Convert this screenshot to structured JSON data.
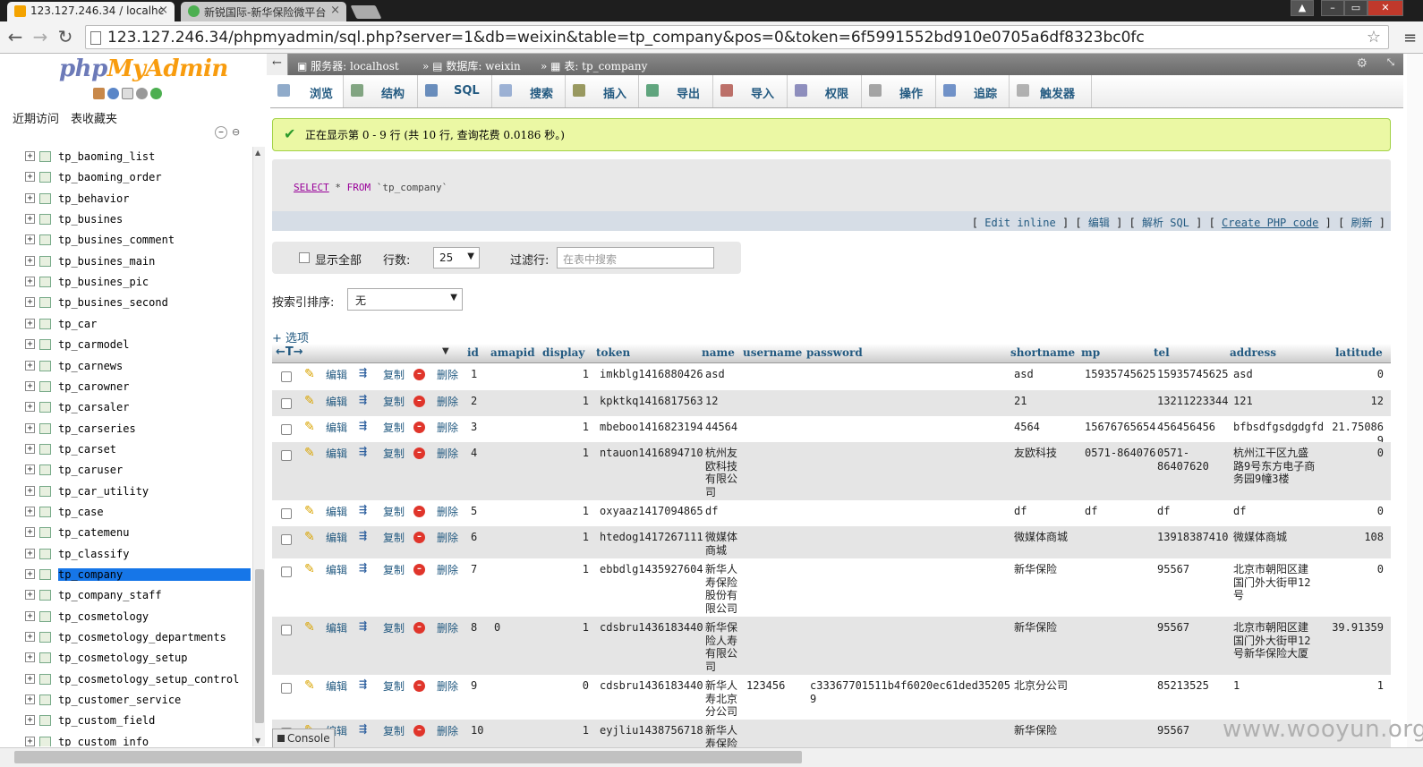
{
  "browser": {
    "tabs": [
      {
        "title": "123.127.246.34 / localhc",
        "close": "×"
      },
      {
        "title": "新锐国际-新华保险微平台",
        "close": "×"
      }
    ],
    "url": "123.127.246.34/phpmyadmin/sql.php?server=1&db=weixin&table=tp_company&pos=0&token=6f5991552bd910e0705a6df8323bc0fc",
    "nav": {
      "back": "←",
      "forward": "→",
      "reload": "↻",
      "star": "☆",
      "menu": "≡"
    }
  },
  "sidebar": {
    "logo_a": "php",
    "logo_b": "MyAdmin",
    "tab_recent": "近期访问",
    "tab_favorites": "表收藏夹",
    "tables": [
      "tp_baoming_list",
      "tp_baoming_order",
      "tp_behavior",
      "tp_busines",
      "tp_busines_comment",
      "tp_busines_main",
      "tp_busines_pic",
      "tp_busines_second",
      "tp_car",
      "tp_carmodel",
      "tp_carnews",
      "tp_carowner",
      "tp_carsaler",
      "tp_carseries",
      "tp_carset",
      "tp_caruser",
      "tp_car_utility",
      "tp_case",
      "tp_catemenu",
      "tp_classify",
      "tp_company",
      "tp_company_staff",
      "tp_cosmetology",
      "tp_cosmetology_departments",
      "tp_cosmetology_setup",
      "tp_cosmetology_setup_control",
      "tp_customer_service",
      "tp_custom_field",
      "tp_custom_info"
    ],
    "selected": "tp_company"
  },
  "breadcrumb": {
    "server": "服务器: localhost",
    "database": "数据库: weixin",
    "table": "表: tp_company"
  },
  "menu_tabs": [
    "浏览",
    "结构",
    "SQL",
    "搜索",
    "插入",
    "导出",
    "导入",
    "权限",
    "操作",
    "追踪",
    "触发器"
  ],
  "message": "正在显示第 0 - 9 行 (共 10 行, 查询花费 0.0186 秒。)",
  "sql": {
    "select": "SELECT",
    "star": " * ",
    "from": "FROM",
    "table": " `tp_company`",
    "links": {
      "edit_inline": "Edit inline",
      "edit": "编辑",
      "explain": "解析 SQL",
      "create_php": "Create PHP code",
      "refresh": "刷新"
    }
  },
  "nav_controls": {
    "show_all": "显示全部",
    "rows_label": "行数:",
    "rows_value": "25",
    "filter_label": "过滤行:",
    "filter_placeholder": "在表中搜索"
  },
  "sort": {
    "label": "按索引排序:",
    "value": "无"
  },
  "options_link": "+ 选项",
  "row_actions": {
    "edit": "编辑",
    "copy": "复制",
    "delete": "删除"
  },
  "table": {
    "columns": [
      "id",
      "amapid",
      "display",
      "token",
      "name",
      "username",
      "password",
      "shortname",
      "mp",
      "tel",
      "address",
      "latitude"
    ],
    "rows": [
      {
        "id": "1",
        "amapid": "",
        "display": "1",
        "token": "imkblg1416880426",
        "name": "asd",
        "username": "",
        "password": "",
        "shortname": "asd",
        "mp": "15935745625",
        "tel": "15935745625",
        "address": "asd",
        "latitude": "0"
      },
      {
        "id": "2",
        "amapid": "",
        "display": "1",
        "token": "kpktkq1416817563",
        "name": "12",
        "username": "",
        "password": "",
        "shortname": "21",
        "mp": "",
        "tel": "13211223344",
        "address": "121",
        "latitude": "12"
      },
      {
        "id": "3",
        "amapid": "",
        "display": "1",
        "token": "mbeboo1416823194",
        "name": "44564",
        "username": "",
        "password": "",
        "shortname": "4564",
        "mp": "15676765654",
        "tel": "456456456",
        "address": "bfbsdfgsdgdgfd",
        "latitude": "21.750869"
      },
      {
        "id": "4",
        "amapid": "",
        "display": "1",
        "token": "ntauon1416894710",
        "name": "杭州友\n欧科技\n有限公\n司",
        "username": "",
        "password": "",
        "shortname": "友欧科技",
        "mp": "0571-864076",
        "tel": "0571-\n86407620",
        "address": "杭州江干区九盛\n路9号东方电子商\n务园9幢3楼",
        "latitude": "0"
      },
      {
        "id": "5",
        "amapid": "",
        "display": "1",
        "token": "oxyaaz1417094865",
        "name": "df",
        "username": "",
        "password": "",
        "shortname": "df",
        "mp": "df",
        "tel": "df",
        "address": "df",
        "latitude": "0"
      },
      {
        "id": "6",
        "amapid": "",
        "display": "1",
        "token": "htedog1417267111",
        "name": "微媒体\n商城",
        "username": "",
        "password": "",
        "shortname": "微媒体商城",
        "mp": "",
        "tel": "13918387410",
        "address": "微媒体商城",
        "latitude": "108"
      },
      {
        "id": "7",
        "amapid": "",
        "display": "1",
        "token": "ebbdlg1435927604",
        "name": "新华人\n寿保险\n股份有\n限公司",
        "username": "",
        "password": "",
        "shortname": "新华保险",
        "mp": "",
        "tel": "95567",
        "address": "北京市朝阳区建\n国门外大街甲12\n号",
        "latitude": "0"
      },
      {
        "id": "8",
        "amapid": "0",
        "display": "1",
        "token": "cdsbru1436183440",
        "name": "新华保\n险人寿\n有限公\n司",
        "username": "",
        "password": "",
        "shortname": "新华保险",
        "mp": "",
        "tel": "95567",
        "address": "北京市朝阳区建\n国门外大街甲12\n号新华保险大厦",
        "latitude": "39.91359"
      },
      {
        "id": "9",
        "amapid": "",
        "display": "0",
        "token": "cdsbru1436183440",
        "name": "新华人\n寿北京\n分公司",
        "username": "123456",
        "password": "c33367701511b4f6020ec61ded352059",
        "shortname": "北京分公司",
        "mp": "",
        "tel": "85213525",
        "address": "1",
        "latitude": "1"
      },
      {
        "id": "10",
        "amapid": "",
        "display": "1",
        "token": "eyjliu1438756718",
        "name": "新华人\n寿保险",
        "username": "",
        "password": "",
        "shortname": "新华保险",
        "mp": "",
        "tel": "95567",
        "address": "",
        "latitude": ""
      }
    ]
  },
  "console": "Console",
  "watermark": "www.wooyun.org",
  "colors": {
    "accent": "#235a81",
    "success_bg": "#ebf8a4",
    "selected": "#1676e8"
  }
}
